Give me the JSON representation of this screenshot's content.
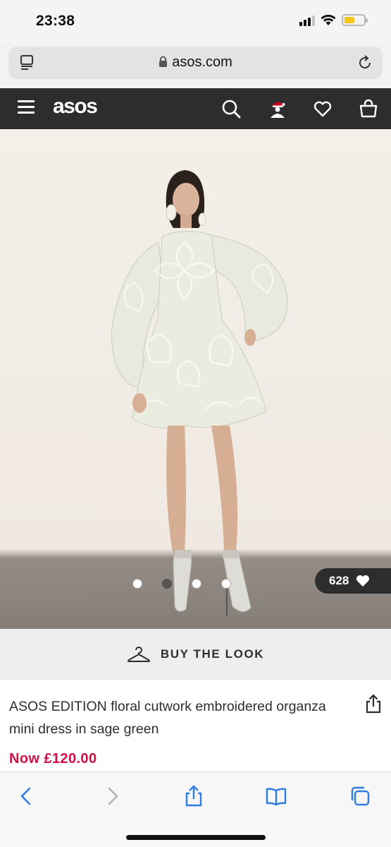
{
  "status_bar": {
    "time": "23:38",
    "battery_level": 0.55,
    "signal_bars": 3
  },
  "browser": {
    "url": "asos.com"
  },
  "header": {
    "logo": "asos",
    "icons": [
      "menu-icon",
      "search-icon",
      "account-icon",
      "wishlist-icon",
      "bag-icon"
    ]
  },
  "gallery": {
    "image_count": 4,
    "active_index": 1,
    "likes_count": "628"
  },
  "buy_the_look": {
    "label": "BUY THE LOOK"
  },
  "product": {
    "title": "ASOS EDITION floral cutwork embroidered organza mini dress in sage green",
    "price": "Now £120.00"
  },
  "colors": {
    "header_bg": "#2d2d2d",
    "price_red": "#d01345",
    "safari_blue": "#2f7de1"
  }
}
